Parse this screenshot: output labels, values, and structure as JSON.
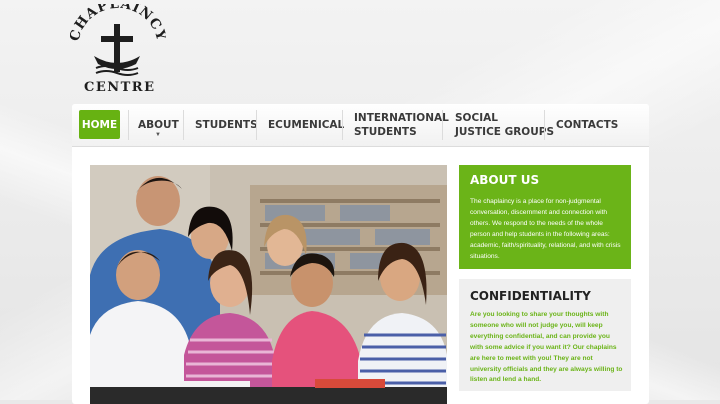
{
  "brand": {
    "arc_text": "CHAPLAINCY",
    "sub_text": "CENTRE",
    "logo_icon": "cross-boat-icon"
  },
  "nav": {
    "items": [
      {
        "label": "HOME",
        "active": true
      },
      {
        "label": "ABOUT",
        "has_dropdown": true
      },
      {
        "label": "STUDENTS"
      },
      {
        "label": "ECUMENICAL"
      },
      {
        "label_line1": "INTERNATIONAL",
        "label_line2": "STUDENTS"
      },
      {
        "label_line1": "SOCIAL",
        "label_line2": "JUSTICE GROUPS"
      },
      {
        "label": "CONTACTS"
      }
    ],
    "dropdown_icon": "caret-down-icon"
  },
  "hero": {
    "image": "group-of-students-photo"
  },
  "about": {
    "title": "ABOUT US",
    "text": "The chaplaincy is a place for non-judgmental conversation, discernment and connection with others. We respond to the needs of the whole person and help students in the following areas: academic, faith/spirituality, relational, and with crisis situations."
  },
  "confidentiality": {
    "title": "CONFIDENTIALITY",
    "text": "Are you looking to share your thoughts with someone who will not judge you, will keep everything confidential, and can provide you with some advice if you want it? Our chaplains are here to meet with you! They are not university officials and they are always willing to listen and lend a hand."
  },
  "colors": {
    "accent": "#67b212",
    "panel": "#ffffff",
    "background": "#e9e9e9",
    "text_dark": "#3a3a3a"
  }
}
